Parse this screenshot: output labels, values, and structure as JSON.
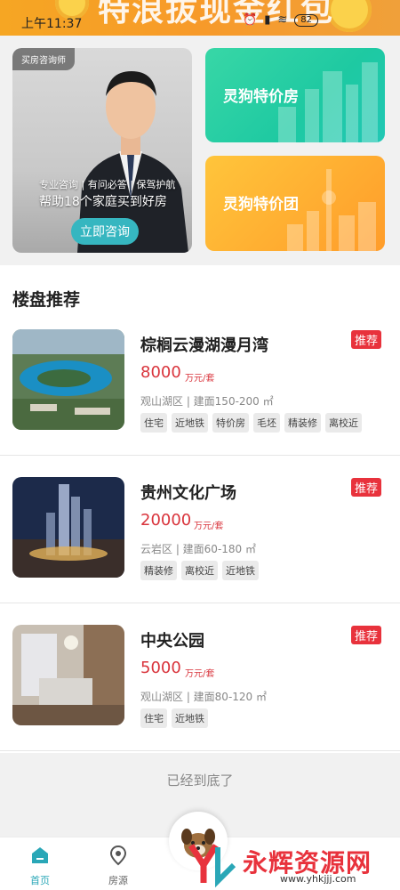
{
  "status_bar": {
    "time": "上午11:37",
    "battery": "82",
    "banner_text": "特浪拔现金红包"
  },
  "hero": {
    "consult_card": {
      "tag": "买房咨询师",
      "subtitle": "专业咨询 | 有问必答 | 保驾护航",
      "headline": "帮助18个家庭买到好房",
      "button": "立即咨询"
    },
    "promo_green": {
      "label": "灵狗特价房"
    },
    "promo_orange": {
      "label": "灵狗特价团"
    }
  },
  "listings": {
    "title": "楼盘推荐",
    "items": [
      {
        "name": "棕榈云漫湖漫月湾",
        "badge": "推荐",
        "price": "8000",
        "unit": "万元/套",
        "meta": "观山湖区 | 建面150-200 ㎡",
        "tags": [
          "住宅",
          "近地铁",
          "特价房",
          "毛坯",
          "精装修",
          "离校近"
        ]
      },
      {
        "name": "贵州文化广场",
        "badge": "推荐",
        "price": "20000",
        "unit": "万元/套",
        "meta": "云岩区 | 建面60-180 ㎡",
        "tags": [
          "精装修",
          "离校近",
          "近地铁"
        ]
      },
      {
        "name": "中央公园",
        "badge": "推荐",
        "price": "5000",
        "unit": "万元/套",
        "meta": "观山湖区 | 建面80-120 ㎡",
        "tags": [
          "住宅",
          "近地铁"
        ]
      }
    ],
    "end_note": "已经到底了"
  },
  "tabbar": {
    "tabs": [
      {
        "label": "首页",
        "icon": "home-icon",
        "active": true
      },
      {
        "label": "房源",
        "icon": "location-pin-icon",
        "active": false
      }
    ]
  },
  "watermark": {
    "text": "永辉资源网",
    "url": "www.yhkjjj.com"
  },
  "colors": {
    "accent": "#2aa7b7",
    "price": "#d9343c",
    "badge": "#e8323c",
    "promo_green": "#1ec9a2",
    "promo_orange": "#ff9c2a"
  }
}
